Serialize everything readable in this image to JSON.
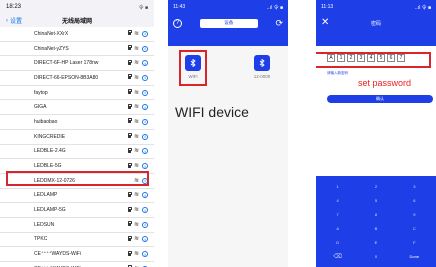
{
  "screen1": {
    "status_time": "18:23",
    "status_right": "令 ■",
    "back_label": "设置",
    "title": "无线局域网",
    "networks": [
      {
        "name": "ChinaNet-XXrX",
        "locked": true
      },
      {
        "name": "ChinaNet-yZYS",
        "locked": true
      },
      {
        "name": "DIRECT-6F-HP Laser 178nw",
        "locked": true
      },
      {
        "name": "DIRECT-66-EPSON-8B3A80",
        "locked": true
      },
      {
        "name": "faytop",
        "locked": true
      },
      {
        "name": "GIGA",
        "locked": true
      },
      {
        "name": "huibaobao",
        "locked": true
      },
      {
        "name": "KINGCREDIE",
        "locked": true
      },
      {
        "name": "LEDBLE-2.4G",
        "locked": true
      },
      {
        "name": "LEDBLE-5G",
        "locked": true
      },
      {
        "name": "LEDDMX-12-0726",
        "locked": false
      },
      {
        "name": "LEDLAMP",
        "locked": true
      },
      {
        "name": "LEDLAMP-5G",
        "locked": true
      },
      {
        "name": "LEDSUN",
        "locked": true
      },
      {
        "name": "TPKC",
        "locked": true
      },
      {
        "name": "CE⁺⁺⁺⁺WAYDS-WiFi",
        "locked": true
      },
      {
        "name": "CE⁺⁺⁺⁺WAYDS-WiFi",
        "locked": true
      }
    ],
    "highlight_color": "#d9262c"
  },
  "screen2": {
    "status_time": "11:43",
    "status_right": "..ıl 令 ■",
    "help_icon": "?",
    "header_pill": "设备",
    "refresh_icon": "⟳",
    "devices": [
      {
        "label": "WiFi",
        "icon": "bluetooth-icon"
      },
      {
        "label": "12-0000",
        "icon": "bluetooth-icon"
      }
    ],
    "caption": "WIFI device",
    "accent": "#1e3fe8"
  },
  "screen3": {
    "status_time": "11:13",
    "status_right": "..ıl 令 ■",
    "close_icon": "✕",
    "title": "密码",
    "password_digits": [
      "A",
      "1",
      "2",
      "3",
      "4",
      "5",
      "6",
      "7"
    ],
    "hint": "请输入新密码",
    "set_password_caption": "set password",
    "confirm_label": "确认",
    "keys": [
      "1",
      "2",
      "3",
      "4",
      "5",
      "6",
      "7",
      "8",
      "9",
      "A",
      "B",
      "C",
      "D",
      "E",
      "F",
      "⌫",
      "0",
      "Done"
    ],
    "caption_color": "#ef1d1d"
  }
}
